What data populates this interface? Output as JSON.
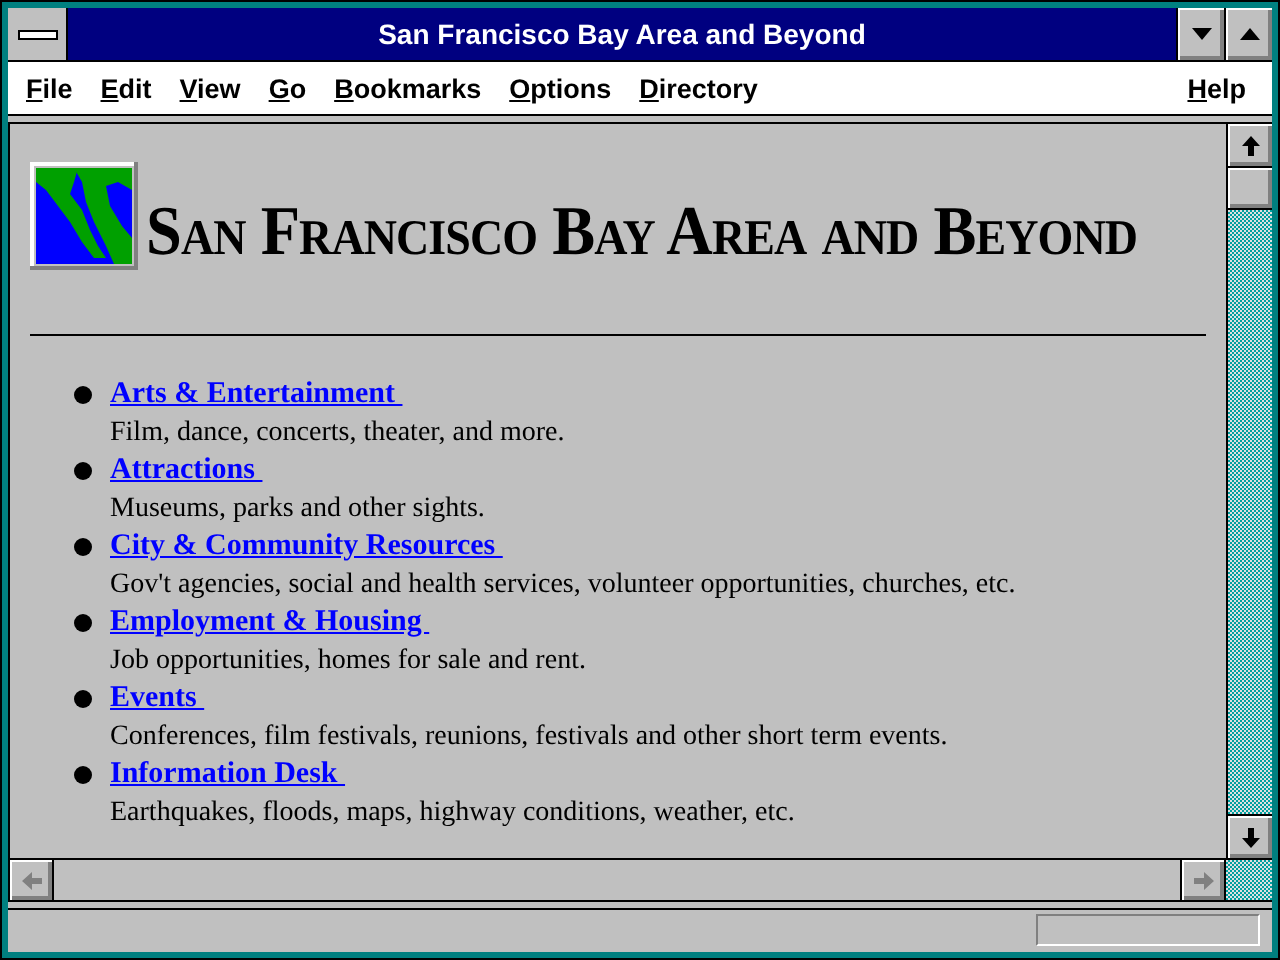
{
  "window": {
    "title": "San Francisco Bay Area and Beyond"
  },
  "menu": [
    "File",
    "Edit",
    "View",
    "Go",
    "Bookmarks",
    "Options",
    "Directory"
  ],
  "help_menu": "Help",
  "page": {
    "heading": "San Francisco Bay Area and Beyond",
    "items": [
      {
        "link": "Arts & Entertainment",
        "description": "Film, dance, concerts, theater, and more."
      },
      {
        "link": "Attractions",
        "description": "Museums, parks and other sights."
      },
      {
        "link": "City & Community Resources",
        "description": "Gov't agencies, social and health services, volunteer opportunities, churches, etc."
      },
      {
        "link": "Employment & Housing",
        "description": "Job opportunities, homes for sale and rent."
      },
      {
        "link": "Events",
        "description": "Conferences, film festivals, reunions, festivals and other short term events."
      },
      {
        "link": "Information Desk",
        "description": "Earthquakes, floods, maps, highway conditions, weather, etc."
      }
    ]
  }
}
